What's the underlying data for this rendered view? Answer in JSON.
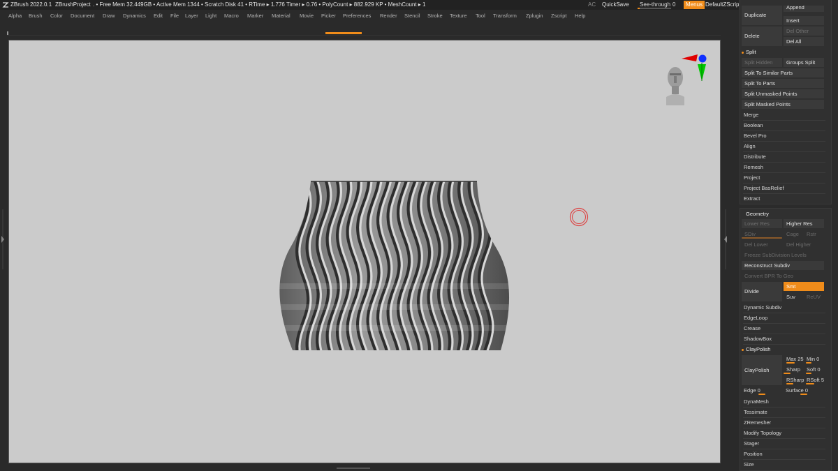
{
  "titlebar": {
    "app": "ZBrush 2022.0.1",
    "project": "ZBrushProject",
    "stats": ". • Free Mem 32.449GB • Active Mem 1344 • Scratch Disk 41 •  RTime ▸ 1.776 Timer ▸ 0.76 • PolyCount ▸ 882.929 KP  • MeshCount ▸ 1",
    "ac": "AC",
    "quicksave": "QuickSave",
    "see_through_label": "See-through",
    "see_through_value": "0",
    "see_through_level": 0.0,
    "menus": "Menus",
    "zscript": "DefaultZScript"
  },
  "menubar": {
    "items": [
      "Alpha",
      "Brush",
      "Color",
      "Document",
      "Draw",
      "Dynamics",
      "Edit",
      "File",
      "Layer",
      "Light",
      "Macro",
      "Marker",
      "Material",
      "Movie",
      "Picker",
      "Preferences",
      "Render",
      "Stencil",
      "Stroke",
      "Texture",
      "Tool",
      "Transform",
      "Zplugin",
      "Zscript",
      "Help"
    ]
  },
  "subtool": {
    "duplicate": "Duplicate",
    "append": "Append",
    "insert": "Insert",
    "delete": "Delete",
    "del_other": "Del Other",
    "del_all": "Del All",
    "split_header": "Split",
    "split_hidden": "Split Hidden",
    "groups_split": "Groups Split",
    "split_similar": "Split To Similar Parts",
    "split_parts": "Split To Parts",
    "split_unmasked": "Split Unmasked Points",
    "split_masked": "Split Masked Points",
    "merge": "Merge",
    "boolean": "Boolean",
    "bevel_pro": "Bevel Pro",
    "align": "Align",
    "distribute": "Distribute",
    "remesh": "Remesh",
    "project": "Project",
    "project_basrelief": "Project BasRelief",
    "extract": "Extract"
  },
  "geometry": {
    "header": "Geometry",
    "lower_res": "Lower Res",
    "higher_res": "Higher Res",
    "sdiv": "SDiv",
    "cage": "Cage",
    "rstr": "Rstr",
    "del_lower": "Del Lower",
    "del_higher": "Del Higher",
    "freeze": "Freeze SubDivision Levels",
    "reconstruct": "Reconstruct Subdiv",
    "convert_bpr": "Convert BPR To Geo",
    "divide": "Divide",
    "smt": "Smt",
    "suv": "Suv",
    "reuv": "ReUV",
    "dynamic_subdiv": "Dynamic Subdiv",
    "edgeloop": "EdgeLoop",
    "crease": "Crease",
    "shadowbox": "ShadowBox",
    "claypolish_header": "ClayPolish",
    "claypolish": "ClayPolish",
    "max": "Max 25",
    "min": "Min 0",
    "sharp": "Sharp",
    "soft": "Soft 0",
    "rsharp": "RSharp",
    "rsoft": "RSoft 5",
    "edge": "Edge 0",
    "surface": "Surface 0",
    "dynamesh": "DynaMesh",
    "tessimate": "Tessimate",
    "zremesher": "ZRemesher",
    "modify_topology": "Modify Topology",
    "stager": "Stager",
    "position": "Position",
    "size": "Size"
  },
  "colors": {
    "accent": "#f08c1a",
    "viewport_bg": "#cbcbcb",
    "ui_bg": "#2a2a2a",
    "button_bg": "#3a3a3a"
  },
  "icons": {
    "logo": "zbrush-logo-icon",
    "head": "orientation-head-icon",
    "gizmo": "axis-gizmo-icon",
    "cursor": "brush-cursor-icon"
  }
}
